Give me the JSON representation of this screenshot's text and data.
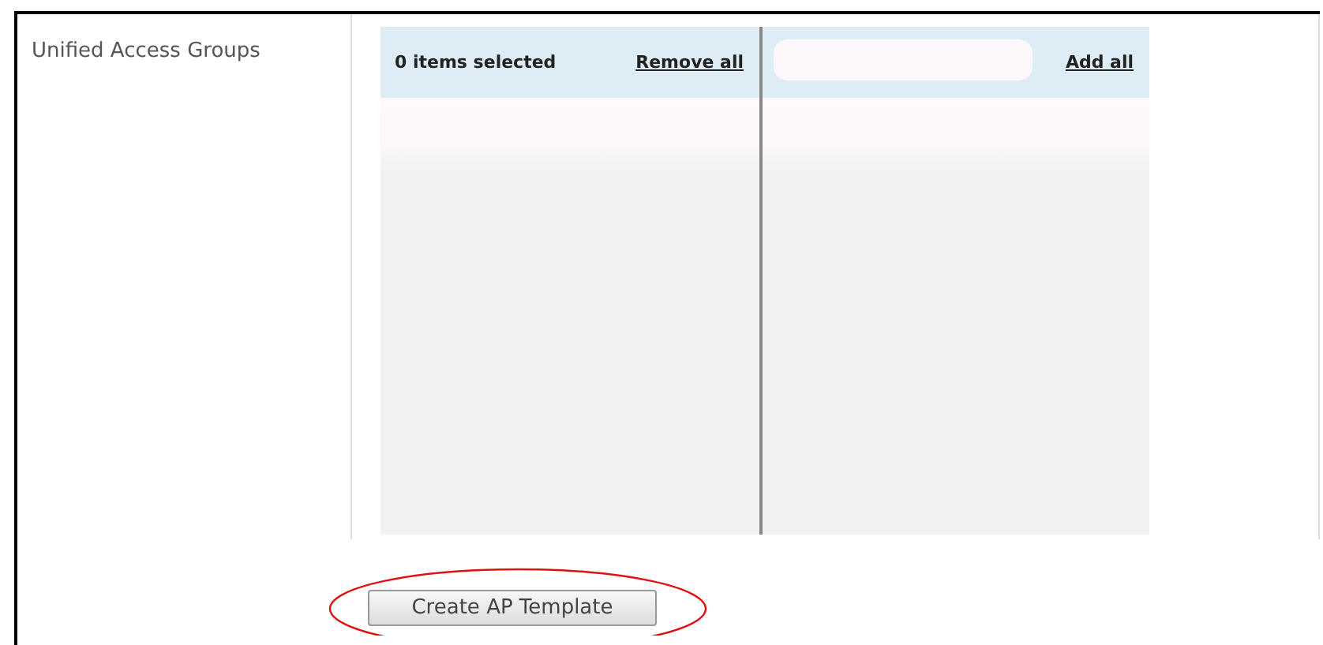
{
  "field_label": "Unified Access Groups",
  "selected_list": {
    "count_text": "0 items selected",
    "remove_link": "Remove all"
  },
  "available_list": {
    "add_link": "Add all"
  },
  "submit_button": "Create AP Template"
}
